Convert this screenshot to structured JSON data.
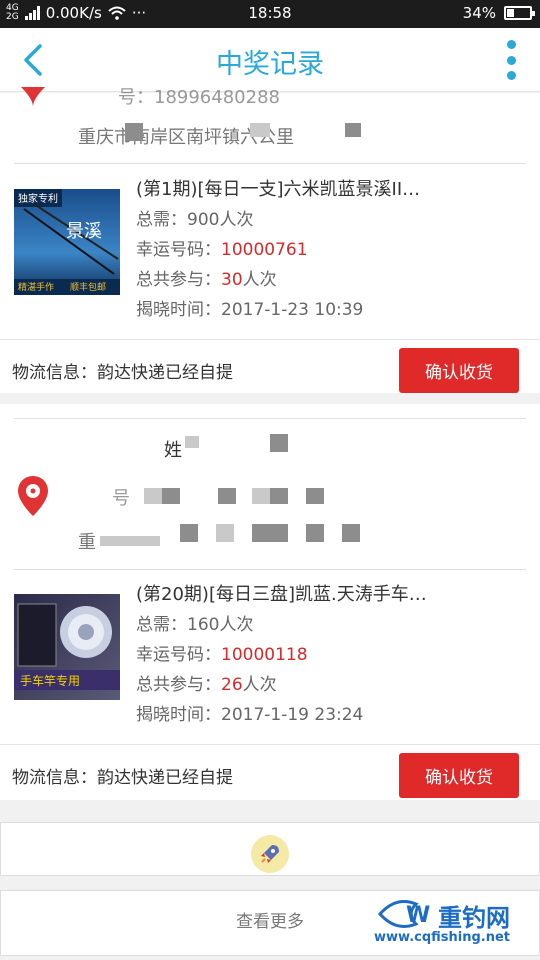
{
  "status_bar": {
    "network": "4G",
    "network2": "2G",
    "speed": "0.00K/s",
    "dots": "···",
    "time": "18:58",
    "battery": "34%",
    "battery_level": 0.34
  },
  "header": {
    "title": "中奖记录"
  },
  "records": [
    {
      "address_partial_1": "号：18996480288",
      "address_partial_2": "重庆市南岸区南坪镇六公里",
      "product": {
        "name": "(第1期)[每日一支]六米凯蓝景溪II…",
        "need_label": "总需：",
        "need_value": "900人次",
        "lucky_label": "幸运号码：",
        "lucky_value": "10000761",
        "total_label": "总共参与：",
        "total_value": "30",
        "total_unit": "人次",
        "time_label": "揭晓时间：",
        "time_value": "2017-1-23 10:39"
      },
      "logistics_text": "物流信息：韵达快递已经自提",
      "confirm_label": "确认收货"
    },
    {
      "name_label": "姓",
      "phone_label": "号",
      "address_partial": "重",
      "product": {
        "name": "(第20期)[每日三盘]凯蓝.天涛手车…",
        "need_label": "总需：",
        "need_value": "160人次",
        "lucky_label": "幸运号码：",
        "lucky_value": "10000118",
        "total_label": "总共参与：",
        "total_value": "26",
        "total_unit": "人次",
        "time_label": "揭晓时间：",
        "time_value": "2017-1-19 23:24"
      },
      "logistics_text": "物流信息：韵达快递已经自提",
      "confirm_label": "确认收货"
    }
  ],
  "thumb1_text": {
    "top": "独家专利",
    "mid": "景溪",
    "bottom_left": "精湛手作",
    "bottom_right": "顺丰包邮"
  },
  "thumb2_text": {
    "label": "手车竿专用"
  },
  "view_more_label": "查看更多",
  "watermark": {
    "cn": "重钓网",
    "url": "www.cqfishing.net"
  },
  "colors": {
    "accent": "#29a9d8",
    "red": "#d52a2a",
    "button": "#e02a2a"
  }
}
